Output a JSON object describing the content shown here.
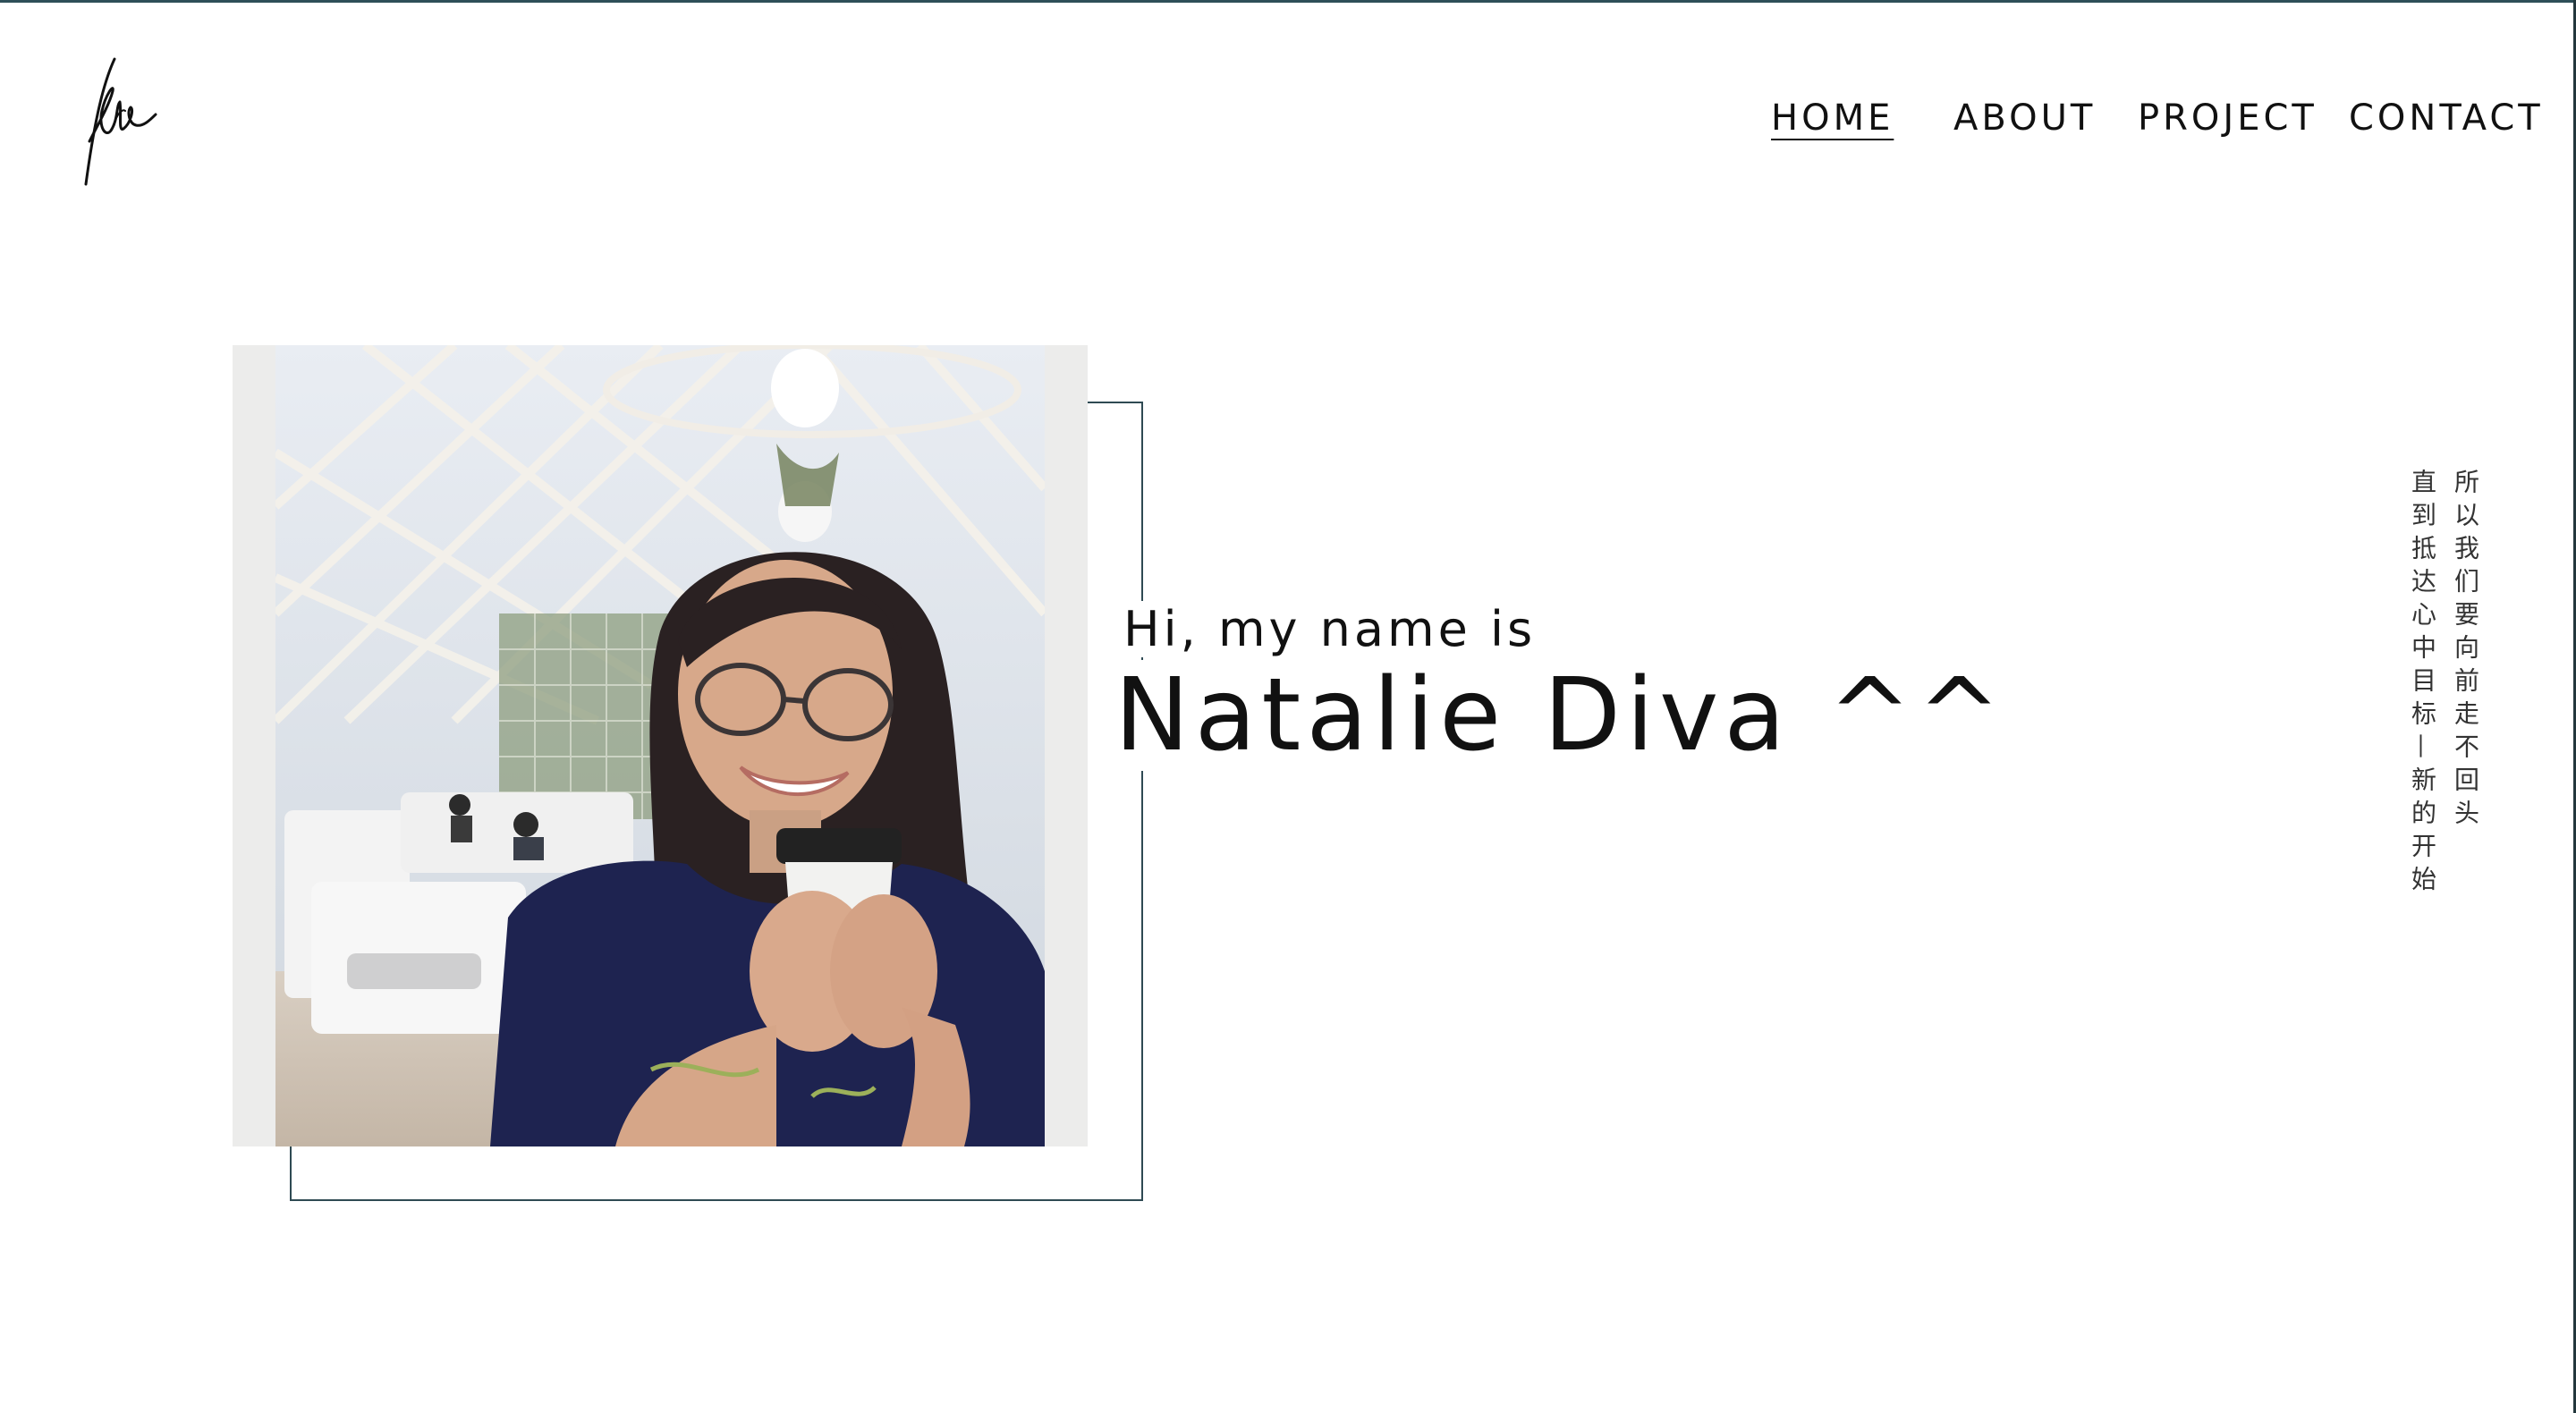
{
  "brand": {
    "logo_icon": "signature-logo-icon"
  },
  "nav": {
    "items": [
      {
        "label": "HOME",
        "active": true
      },
      {
        "label": "ABOUT",
        "active": false
      },
      {
        "label": "PROJECT",
        "active": false
      },
      {
        "label": "CONTACT",
        "active": false
      }
    ]
  },
  "hero": {
    "greeting": "Hi, my name is",
    "name": "Natalie Diva ^^",
    "portrait_icon": "portrait-photo"
  },
  "poem": {
    "lines": [
      "所以我们要向前走不回头",
      "直到抵达心中目标—新的开始"
    ]
  },
  "colors": {
    "accent": "#2e4f58",
    "text": "#111111",
    "photo_backing": "#ececeb"
  }
}
